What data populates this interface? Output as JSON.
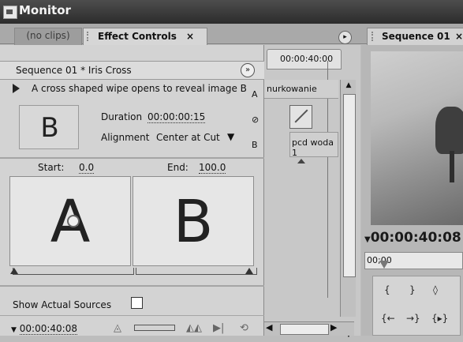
{
  "window": {
    "title": "Monitor"
  },
  "tabs": {
    "no_clips": "(no clips)",
    "effect_controls": "Effect Controls",
    "effect_controls_close": "×",
    "menu_glyph": "▸",
    "sequence": "Sequence 01",
    "sequence_close": "×"
  },
  "effect_controls": {
    "header": "Sequence 01 * Iris Cross",
    "header_button": "»",
    "description": "A cross shaped wipe opens to reveal image B",
    "thumbnail_letter": "B",
    "duration_label": "Duration",
    "duration_value": "00:00:00:15",
    "alignment_label": "Alignment",
    "alignment_value": "Center at Cut",
    "alignment_arrow": "▼",
    "start_label": "Start:",
    "start_value": "0.0",
    "end_label": "End:",
    "end_value": "100.0",
    "preview_a": "A",
    "preview_b": "B",
    "show_actual_sources": "Show Actual Sources",
    "show_actual_sources_checked": false,
    "current_timecode": "00:00:40:08",
    "timecode_marker": "▼"
  },
  "mini_timeline": {
    "ruler_time": "00:00:40:00",
    "track_a_label": "A",
    "track_b_label": "B",
    "clip_a": "nurkowanie",
    "clip_b": "pcd woda 1",
    "scroll_up": "▲",
    "scroll_down": "▼",
    "scroll_left": "◀",
    "scroll_right": "▶"
  },
  "sequence_monitor": {
    "timecode": "00:00:40:08",
    "timecode_marker": "▼",
    "ruler_time": "00;00",
    "controls_row1": [
      "{",
      "}",
      "◊"
    ],
    "controls_row2": [
      "{←",
      "→}",
      "{▸}"
    ]
  }
}
